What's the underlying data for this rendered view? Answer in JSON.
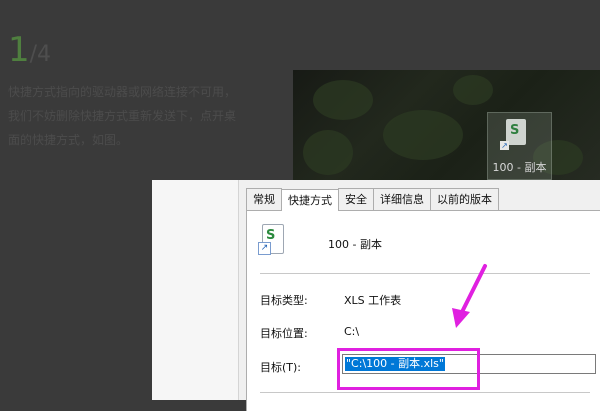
{
  "step": {
    "current": "1",
    "total": "/4"
  },
  "instructions": [
    "快捷方式指向的驱动器或网络连接不可用，",
    "我们不妨删除快捷方式重新发送下，点开桌",
    "面的快捷方式，如图。"
  ],
  "desktop": {
    "icon_label": "100 - 副本",
    "icon_glyph": "S"
  },
  "dialog": {
    "tabs": [
      "常规",
      "快捷方式",
      "安全",
      "详细信息",
      "以前的版本"
    ],
    "active_tab": 1,
    "file_name": "100 - 副本",
    "file_glyph": "S",
    "target_type_label": "目标类型:",
    "target_type_value": "XLS 工作表",
    "target_location_label": "目标位置:",
    "target_location_value": "C:\\",
    "target_label": "目标(T):",
    "target_value": "\"C:\\100 - 副本.xls\""
  },
  "colors": {
    "highlight": "#e020e0",
    "selection": "#0078d7",
    "step_green": "#4f7f3f"
  }
}
